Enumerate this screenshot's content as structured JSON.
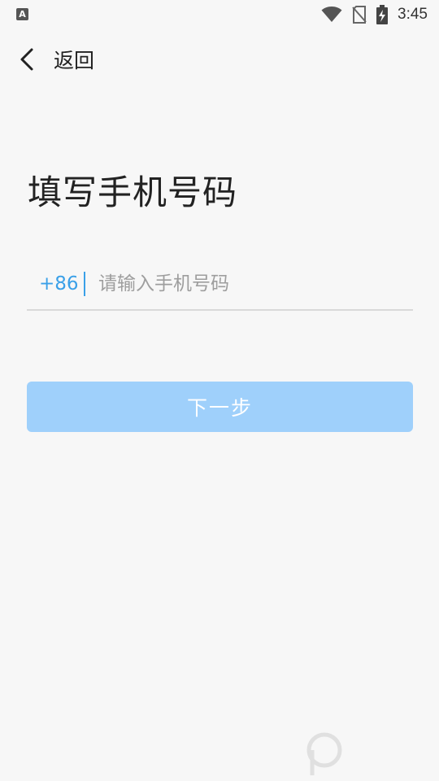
{
  "status_bar": {
    "app_indicator": "A",
    "time": "3:45",
    "icons": [
      "wifi-icon",
      "no-sim-icon",
      "battery-charging-icon"
    ]
  },
  "nav": {
    "back_label": "返回"
  },
  "page": {
    "title": "填写手机号码"
  },
  "phone": {
    "country_code": "+86",
    "placeholder": "请输入手机号码",
    "value": ""
  },
  "actions": {
    "next_label": "下一步"
  },
  "colors": {
    "accent": "#3aa0e8",
    "button_disabled_bg": "#9fd0fb",
    "background": "#f7f7f7"
  }
}
